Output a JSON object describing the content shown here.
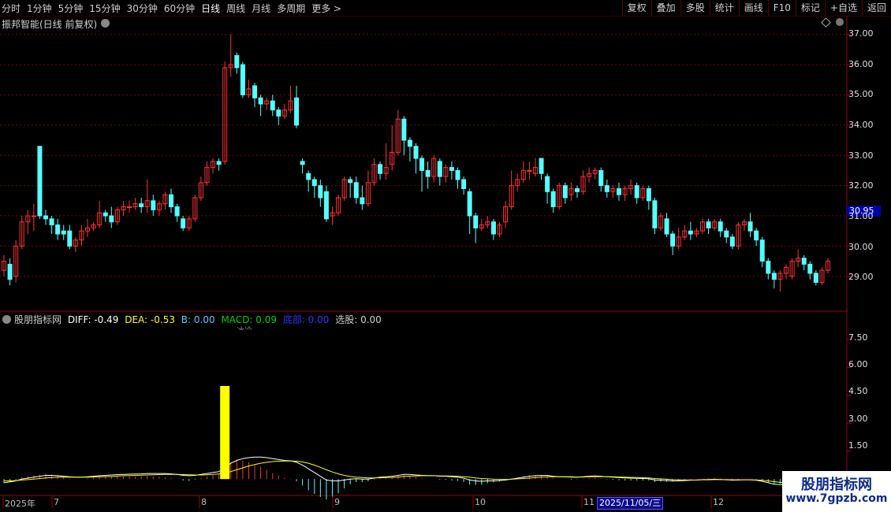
{
  "toolbar": {
    "left_items": [
      "分时",
      "1分钟",
      "5分钟",
      "15分钟",
      "30分钟",
      "60分钟",
      "日线",
      "周线",
      "月线",
      "多周期",
      "更多 >"
    ],
    "active_item": "日线",
    "right_items": [
      "复权",
      "叠加",
      "多股",
      "统计",
      "画线",
      "F10",
      "标记",
      "+自选",
      "返回"
    ]
  },
  "chart_title": "振邦智能(日线 前复权)",
  "price_axis": [
    "37.00",
    "36.00",
    "35.00",
    "34.00",
    "33.00",
    "32.00",
    "31.00",
    "30.00",
    "29.00"
  ],
  "current_price": "30.95",
  "indicator": {
    "name": "股朋指标网",
    "diff": "DIFF: -0.49",
    "dea": "DEA: -0.53",
    "b": "B: 0.00",
    "macd": "MACD: 0.09",
    "dibu": "底部: 0.00",
    "xuangu": "选股: 0.00",
    "note": "冰冷",
    "axis": [
      "7.50",
      "6.00",
      "4.50",
      "3.00",
      "1.50"
    ]
  },
  "dates": [
    {
      "label": "2025年"
    },
    {
      "label": "7"
    },
    {
      "label": "8"
    },
    {
      "label": "9"
    },
    {
      "label": "10"
    },
    {
      "label": "11"
    },
    {
      "label": "12"
    }
  ],
  "cursor_date": "2025/11/05/三",
  "watermark": {
    "title": "股朋指标网",
    "url": "www.7gpzb.com"
  },
  "colors": {
    "up": "#ff3232",
    "down": "#54ffff",
    "diff": "#ffffff",
    "dea": "#ffff00",
    "grid": "#7a0000",
    "axis": "#a00000",
    "bar": "#ffff00"
  },
  "chart_data": {
    "type": "candlestick",
    "ylim": [
      28.5,
      37.2
    ],
    "candles": [
      [
        29.2,
        29.5,
        29.0,
        29.7
      ],
      [
        29.4,
        28.9,
        28.7,
        29.6
      ],
      [
        29.0,
        30.0,
        28.8,
        30.2
      ],
      [
        30.0,
        30.8,
        29.9,
        31.0
      ],
      [
        30.8,
        31.0,
        30.4,
        31.2
      ],
      [
        31.0,
        31.0,
        30.5,
        31.4
      ],
      [
        33.3,
        31.0,
        30.9,
        33.3
      ],
      [
        31.0,
        30.9,
        30.7,
        31.2
      ],
      [
        30.9,
        30.7,
        30.4,
        31.0
      ],
      [
        30.7,
        30.4,
        30.2,
        30.9
      ],
      [
        30.5,
        30.4,
        30.2,
        30.7
      ],
      [
        30.5,
        30.0,
        29.9,
        30.7
      ],
      [
        30.0,
        30.2,
        29.8,
        30.3
      ],
      [
        30.2,
        30.5,
        30.0,
        30.7
      ],
      [
        30.5,
        30.6,
        30.3,
        30.9
      ],
      [
        30.6,
        30.7,
        30.5,
        30.8
      ],
      [
        30.7,
        31.1,
        30.6,
        31.5
      ],
      [
        31.1,
        31.0,
        30.8,
        31.2
      ],
      [
        31.0,
        30.8,
        30.6,
        31.3
      ],
      [
        30.8,
        31.2,
        30.7,
        31.3
      ],
      [
        31.2,
        31.3,
        31.0,
        31.5
      ],
      [
        31.3,
        31.3,
        31.1,
        31.5
      ],
      [
        31.3,
        31.4,
        31.2,
        31.6
      ],
      [
        31.4,
        31.3,
        31.1,
        31.6
      ],
      [
        31.3,
        31.5,
        31.1,
        32.2
      ],
      [
        31.5,
        31.2,
        31.0,
        31.7
      ],
      [
        31.2,
        31.4,
        31.0,
        31.5
      ],
      [
        31.4,
        31.7,
        31.2,
        31.8
      ],
      [
        31.7,
        31.3,
        31.1,
        31.9
      ],
      [
        31.3,
        31.0,
        30.8,
        31.4
      ],
      [
        30.9,
        30.6,
        30.5,
        31.0
      ],
      [
        30.6,
        30.9,
        30.5,
        31.0
      ],
      [
        30.9,
        31.6,
        30.8,
        31.7
      ],
      [
        31.6,
        32.1,
        31.5,
        32.3
      ],
      [
        32.1,
        32.6,
        32.0,
        32.8
      ],
      [
        32.6,
        32.8,
        32.4,
        32.9
      ],
      [
        32.8,
        32.7,
        32.5,
        32.9
      ],
      [
        32.8,
        35.9,
        32.7,
        36.1
      ],
      [
        35.9,
        36.0,
        35.6,
        37.0
      ],
      [
        36.3,
        35.9,
        35.7,
        36.4
      ],
      [
        36.0,
        35.0,
        34.9,
        36.1
      ],
      [
        35.0,
        35.2,
        34.9,
        35.5
      ],
      [
        35.3,
        34.9,
        34.6,
        35.4
      ],
      [
        34.9,
        34.7,
        34.3,
        35.0
      ],
      [
        34.7,
        34.8,
        34.5,
        34.9
      ],
      [
        34.8,
        34.5,
        34.3,
        35.0
      ],
      [
        34.5,
        34.3,
        34.0,
        34.6
      ],
      [
        34.3,
        34.5,
        34.2,
        34.7
      ],
      [
        34.5,
        34.8,
        34.4,
        35.3
      ],
      [
        34.9,
        34.0,
        33.9,
        35.3
      ],
      [
        32.8,
        32.7,
        32.4,
        32.9
      ],
      [
        32.4,
        32.2,
        31.8,
        32.5
      ],
      [
        32.2,
        32.0,
        31.6,
        32.3
      ],
      [
        32.0,
        31.6,
        31.3,
        32.2
      ],
      [
        31.8,
        30.9,
        30.8,
        32.0
      ],
      [
        31.0,
        31.1,
        30.7,
        31.3
      ],
      [
        31.1,
        31.6,
        31.0,
        31.7
      ],
      [
        31.6,
        32.2,
        31.5,
        32.3
      ],
      [
        32.2,
        32.1,
        31.6,
        32.3
      ],
      [
        32.1,
        31.6,
        31.4,
        32.3
      ],
      [
        31.6,
        31.4,
        31.2,
        32.0
      ],
      [
        31.4,
        32.1,
        31.3,
        32.5
      ],
      [
        32.1,
        32.7,
        32.0,
        32.9
      ],
      [
        32.7,
        32.4,
        32.2,
        32.8
      ],
      [
        32.4,
        32.6,
        32.2,
        33.4
      ],
      [
        32.7,
        33.1,
        32.5,
        34.0
      ],
      [
        33.1,
        34.2,
        33.0,
        34.5
      ],
      [
        34.2,
        33.5,
        33.0,
        34.3
      ],
      [
        33.5,
        33.3,
        32.8,
        33.6
      ],
      [
        33.3,
        32.9,
        32.4,
        33.4
      ],
      [
        32.9,
        32.5,
        31.8,
        33.0
      ],
      [
        32.5,
        32.3,
        31.9,
        32.8
      ],
      [
        32.3,
        32.9,
        32.1,
        33.0
      ],
      [
        32.8,
        32.3,
        32.0,
        32.9
      ],
      [
        32.3,
        32.6,
        32.1,
        32.7
      ],
      [
        32.6,
        32.5,
        32.2,
        32.8
      ],
      [
        32.5,
        32.2,
        31.9,
        32.6
      ],
      [
        32.2,
        31.9,
        31.7,
        32.3
      ],
      [
        31.8,
        31.0,
        30.4,
        31.9
      ],
      [
        31.0,
        30.6,
        30.1,
        31.1
      ],
      [
        30.6,
        30.7,
        30.5,
        30.9
      ],
      [
        30.7,
        30.8,
        30.6,
        31.0
      ],
      [
        30.8,
        30.4,
        30.2,
        30.9
      ],
      [
        30.4,
        30.7,
        30.3,
        30.8
      ],
      [
        30.8,
        31.3,
        30.6,
        31.5
      ],
      [
        31.3,
        32.0,
        31.2,
        32.5
      ],
      [
        32.0,
        32.2,
        31.8,
        32.4
      ],
      [
        32.2,
        32.5,
        32.1,
        32.8
      ],
      [
        32.5,
        32.5,
        32.2,
        32.8
      ],
      [
        32.4,
        32.6,
        32.3,
        32.9
      ],
      [
        32.9,
        32.4,
        32.2,
        32.9
      ],
      [
        32.3,
        31.8,
        31.4,
        32.4
      ],
      [
        31.8,
        31.3,
        31.1,
        31.9
      ],
      [
        31.3,
        32.0,
        31.2,
        32.1
      ],
      [
        32.0,
        31.6,
        31.4,
        32.1
      ],
      [
        31.7,
        31.9,
        31.5,
        32.1
      ],
      [
        31.9,
        31.8,
        31.6,
        32.0
      ],
      [
        31.8,
        32.3,
        31.7,
        32.5
      ],
      [
        32.3,
        32.4,
        32.1,
        32.6
      ],
      [
        32.4,
        32.5,
        32.2,
        32.6
      ],
      [
        32.5,
        32.0,
        31.8,
        32.6
      ],
      [
        32.0,
        31.8,
        31.6,
        32.2
      ],
      [
        31.8,
        31.9,
        31.6,
        32.0
      ],
      [
        31.9,
        31.7,
        31.5,
        32.1
      ],
      [
        31.7,
        31.9,
        31.5,
        32.0
      ],
      [
        31.9,
        32.0,
        31.7,
        32.2
      ],
      [
        32.0,
        31.6,
        31.4,
        32.1
      ],
      [
        31.6,
        31.9,
        31.5,
        32.0
      ],
      [
        31.9,
        31.5,
        31.2,
        32.0
      ],
      [
        31.5,
        30.6,
        30.4,
        31.6
      ],
      [
        30.6,
        31.0,
        30.5,
        31.1
      ],
      [
        30.9,
        30.4,
        30.3,
        31.1
      ],
      [
        30.4,
        30.0,
        29.7,
        30.5
      ],
      [
        30.0,
        30.3,
        29.9,
        30.6
      ],
      [
        30.3,
        30.5,
        30.2,
        30.7
      ],
      [
        30.5,
        30.4,
        30.2,
        30.8
      ],
      [
        30.4,
        30.5,
        30.3,
        30.6
      ],
      [
        30.5,
        30.8,
        30.4,
        30.9
      ],
      [
        30.8,
        30.6,
        30.4,
        30.9
      ],
      [
        30.6,
        30.8,
        30.5,
        30.9
      ],
      [
        30.8,
        30.5,
        30.3,
        30.9
      ],
      [
        30.5,
        30.3,
        30.1,
        30.6
      ],
      [
        30.3,
        30.0,
        29.9,
        30.4
      ],
      [
        30.0,
        30.7,
        29.9,
        30.8
      ],
      [
        30.7,
        30.8,
        30.5,
        30.9
      ],
      [
        30.8,
        30.5,
        30.3,
        31.1
      ],
      [
        30.5,
        30.2,
        30.0,
        30.6
      ],
      [
        30.2,
        29.5,
        29.3,
        30.3
      ],
      [
        29.5,
        29.1,
        28.9,
        29.6
      ],
      [
        29.1,
        28.9,
        28.6,
        29.2
      ],
      [
        28.9,
        29.1,
        28.5,
        29.2
      ],
      [
        29.1,
        29.3,
        28.9,
        29.4
      ],
      [
        29.0,
        29.5,
        28.9,
        29.6
      ],
      [
        29.5,
        29.6,
        29.3,
        29.9
      ],
      [
        29.6,
        29.4,
        29.2,
        29.7
      ],
      [
        29.4,
        29.1,
        28.9,
        29.5
      ],
      [
        29.1,
        28.8,
        28.7,
        29.2
      ],
      [
        28.8,
        29.2,
        28.7,
        29.3
      ],
      [
        29.2,
        29.5,
        29.1,
        29.6
      ]
    ],
    "macd": {
      "ylim": [
        -0.5,
        8.3
      ],
      "diff": [
        -0.2,
        -0.15,
        -0.1,
        0.0,
        0.05,
        0.1,
        0.15,
        0.2,
        0.2,
        0.18,
        0.15,
        0.12,
        0.1,
        0.1,
        0.12,
        0.15,
        0.18,
        0.2,
        0.22,
        0.24,
        0.25,
        0.26,
        0.27,
        0.28,
        0.3,
        0.3,
        0.3,
        0.3,
        0.28,
        0.25,
        0.2,
        0.18,
        0.2,
        0.25,
        0.3,
        0.35,
        0.4,
        0.6,
        0.85,
        1.0,
        1.1,
        1.15,
        1.18,
        1.18,
        1.15,
        1.1,
        1.05,
        1.0,
        0.98,
        0.9,
        0.75,
        0.55,
        0.35,
        0.15,
        -0.05,
        -0.1,
        -0.1,
        -0.05,
        0.0,
        0.02,
        0.0,
        0.0,
        0.05,
        0.1,
        0.12,
        0.15,
        0.2,
        0.25,
        0.25,
        0.22,
        0.2,
        0.18,
        0.18,
        0.15,
        0.15,
        0.12,
        0.1,
        0.05,
        -0.05,
        -0.1,
        -0.12,
        -0.1,
        -0.1,
        -0.08,
        -0.05,
        0.0,
        0.05,
        0.1,
        0.15,
        0.18,
        0.2,
        0.2,
        0.15,
        0.12,
        0.12,
        0.1,
        0.1,
        0.12,
        0.15,
        0.17,
        0.15,
        0.12,
        0.1,
        0.08,
        0.06,
        0.05,
        0.04,
        0.03,
        0.02,
        -0.05,
        -0.06,
        -0.08,
        -0.1,
        -0.1,
        -0.08,
        -0.06,
        -0.05,
        -0.03,
        -0.02,
        -0.01,
        -0.02,
        -0.04,
        -0.06,
        -0.05,
        -0.04,
        -0.04,
        -0.06,
        -0.12,
        -0.2,
        -0.28,
        -0.3,
        -0.3,
        -0.28,
        -0.26,
        -0.27,
        -0.3,
        -0.33,
        -0.36,
        -0.38
      ],
      "dea": [
        -0.1,
        -0.1,
        -0.08,
        -0.05,
        -0.03,
        0.0,
        0.03,
        0.06,
        0.08,
        0.1,
        0.1,
        0.1,
        0.1,
        0.1,
        0.1,
        0.11,
        0.12,
        0.13,
        0.14,
        0.16,
        0.18,
        0.19,
        0.2,
        0.21,
        0.22,
        0.23,
        0.24,
        0.25,
        0.25,
        0.25,
        0.24,
        0.23,
        0.22,
        0.22,
        0.23,
        0.25,
        0.28,
        0.32,
        0.4,
        0.5,
        0.6,
        0.7,
        0.78,
        0.85,
        0.9,
        0.94,
        0.96,
        0.97,
        0.97,
        0.96,
        0.92,
        0.85,
        0.75,
        0.63,
        0.5,
        0.38,
        0.28,
        0.2,
        0.14,
        0.1,
        0.08,
        0.06,
        0.06,
        0.07,
        0.08,
        0.09,
        0.11,
        0.14,
        0.16,
        0.17,
        0.18,
        0.18,
        0.18,
        0.17,
        0.17,
        0.16,
        0.15,
        0.13,
        0.1,
        0.06,
        0.03,
        0.01,
        -0.01,
        -0.02,
        -0.02,
        -0.01,
        0.01,
        0.03,
        0.05,
        0.08,
        0.1,
        0.12,
        0.12,
        0.12,
        0.12,
        0.12,
        0.11,
        0.11,
        0.12,
        0.13,
        0.13,
        0.13,
        0.12,
        0.11,
        0.1,
        0.09,
        0.08,
        0.07,
        0.06,
        0.03,
        0.01,
        -0.01,
        -0.03,
        -0.04,
        -0.05,
        -0.05,
        -0.05,
        -0.04,
        -0.04,
        -0.03,
        -0.03,
        -0.03,
        -0.04,
        -0.04,
        -0.04,
        -0.04,
        -0.05,
        -0.07,
        -0.1,
        -0.14,
        -0.18,
        -0.21,
        -0.23,
        -0.24,
        -0.25,
        -0.26,
        -0.28,
        -0.3,
        -0.33
      ],
      "signal_bar": {
        "index": 37,
        "value": 5.0
      }
    }
  }
}
